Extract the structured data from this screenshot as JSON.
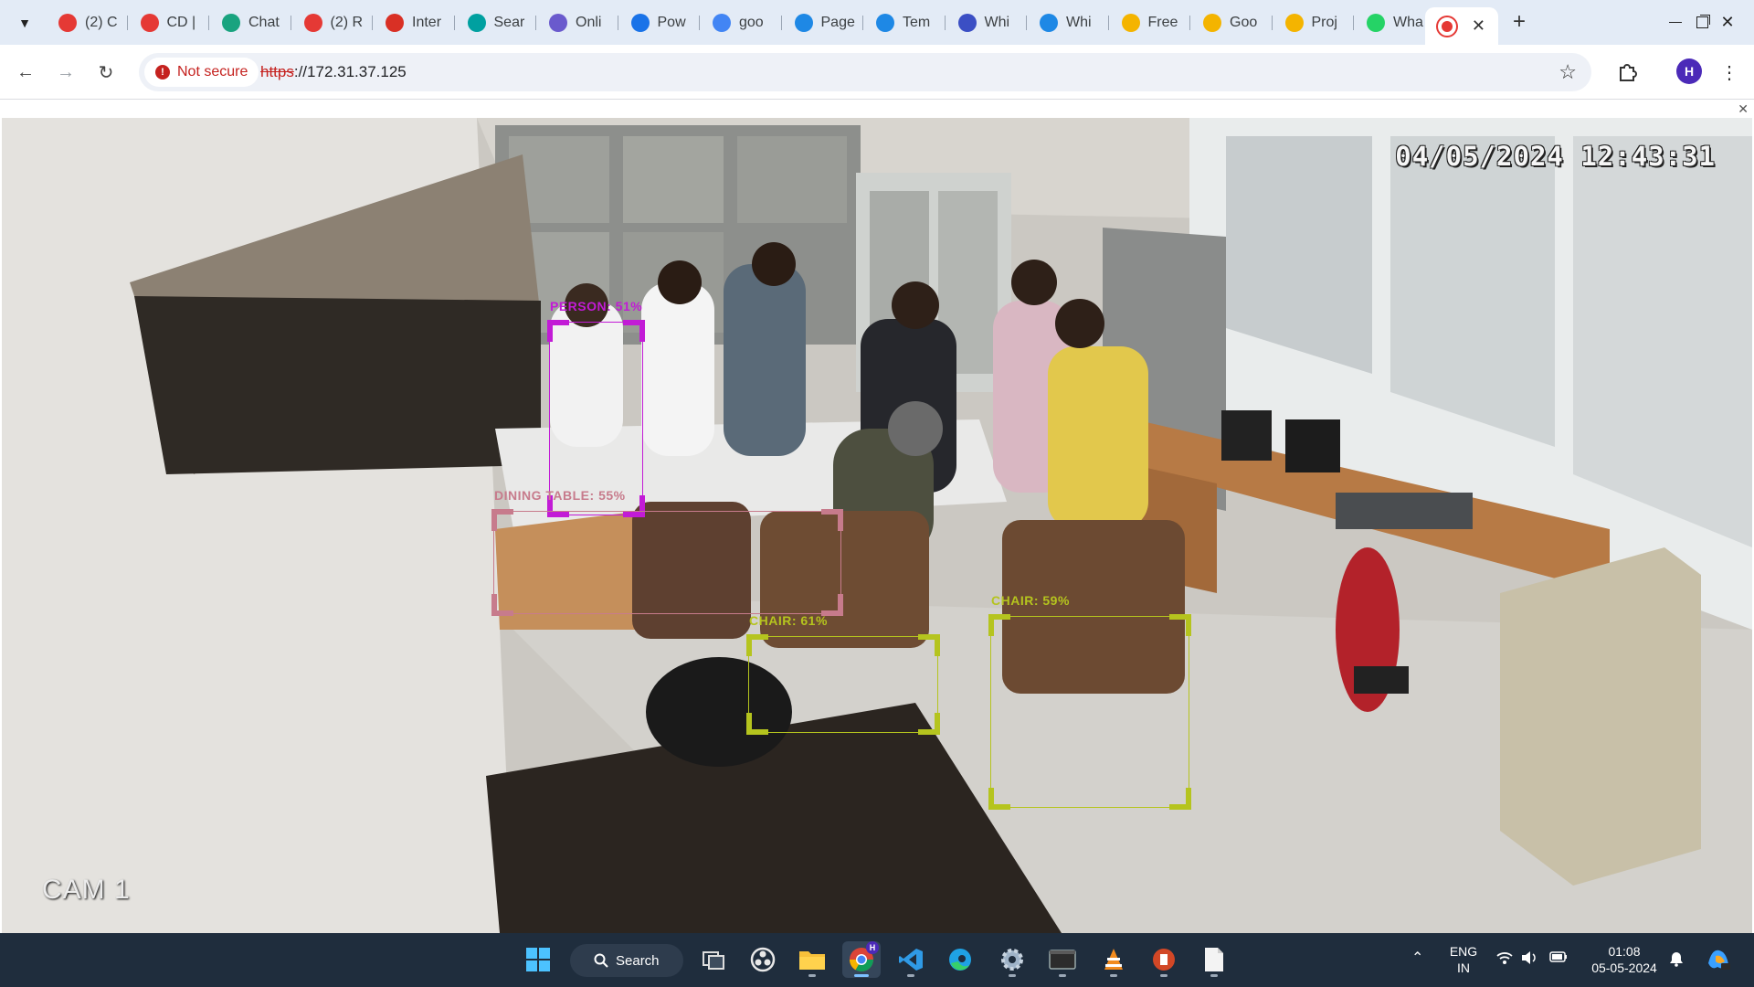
{
  "browser": {
    "tabs": [
      {
        "title": "(2) C",
        "icon": "youtube-icon",
        "color": "#e53935"
      },
      {
        "title": "CD |",
        "icon": "youtube-icon",
        "color": "#e53935"
      },
      {
        "title": "Chat",
        "icon": "chatgpt-icon",
        "color": "#19a37f"
      },
      {
        "title": "(2) R",
        "icon": "youtube-icon",
        "color": "#e53935"
      },
      {
        "title": "Inter",
        "icon": "speedometer-icon",
        "color": "#d93025"
      },
      {
        "title": "Sear",
        "icon": "vercel-icon",
        "color": "#00a0a0"
      },
      {
        "title": "Onli",
        "icon": "circle-app-icon",
        "color": "#6a5acd"
      },
      {
        "title": "Pow",
        "icon": "form-icon",
        "color": "#1a73e8"
      },
      {
        "title": "goo",
        "icon": "google-icon",
        "color": "#4285f4"
      },
      {
        "title": "Page",
        "icon": "canva-icon",
        "color": "#1e88e5"
      },
      {
        "title": "Tem",
        "icon": "canva-icon",
        "color": "#1e88e5"
      },
      {
        "title": "Whi",
        "icon": "shield-app-icon",
        "color": "#3b4fc4"
      },
      {
        "title": "Whi",
        "icon": "canva-icon",
        "color": "#1e88e5"
      },
      {
        "title": "Free",
        "icon": "slides-icon",
        "color": "#f4b400"
      },
      {
        "title": "Goo",
        "icon": "docs-yellow-icon",
        "color": "#f4b400"
      },
      {
        "title": "Proj",
        "icon": "slides-icon",
        "color": "#f4b400"
      },
      {
        "title": "Wha",
        "icon": "whatsapp-icon",
        "color": "#25d366"
      }
    ],
    "active_tab_icon": "camera-app-icon",
    "active_tab_close": "✕",
    "new_tab": "+",
    "security_label": "Not secure",
    "url_scheme": "https",
    "url_rest": "://172.31.37.125",
    "profile_initial": "H"
  },
  "camera": {
    "timestamp": "04/05/2024 12:43:31",
    "label": "CAM 1",
    "detections": [
      {
        "name": "person",
        "label": "PERSON: 51%",
        "color": "#c21bd6"
      },
      {
        "name": "dining-table",
        "label": "DINING TABLE: 55%",
        "color": "#c77b8c"
      },
      {
        "name": "chair-1",
        "label": "CHAIR: 61%",
        "color": "#b5c41e"
      },
      {
        "name": "chair-2",
        "label": "CHAIR: 59%",
        "color": "#b5c41e"
      }
    ]
  },
  "taskbar": {
    "search_label": "Search",
    "language_line1": "ENG",
    "language_line2": "IN",
    "time": "01:08",
    "date": "05-05-2024",
    "profile_badge": "H"
  }
}
